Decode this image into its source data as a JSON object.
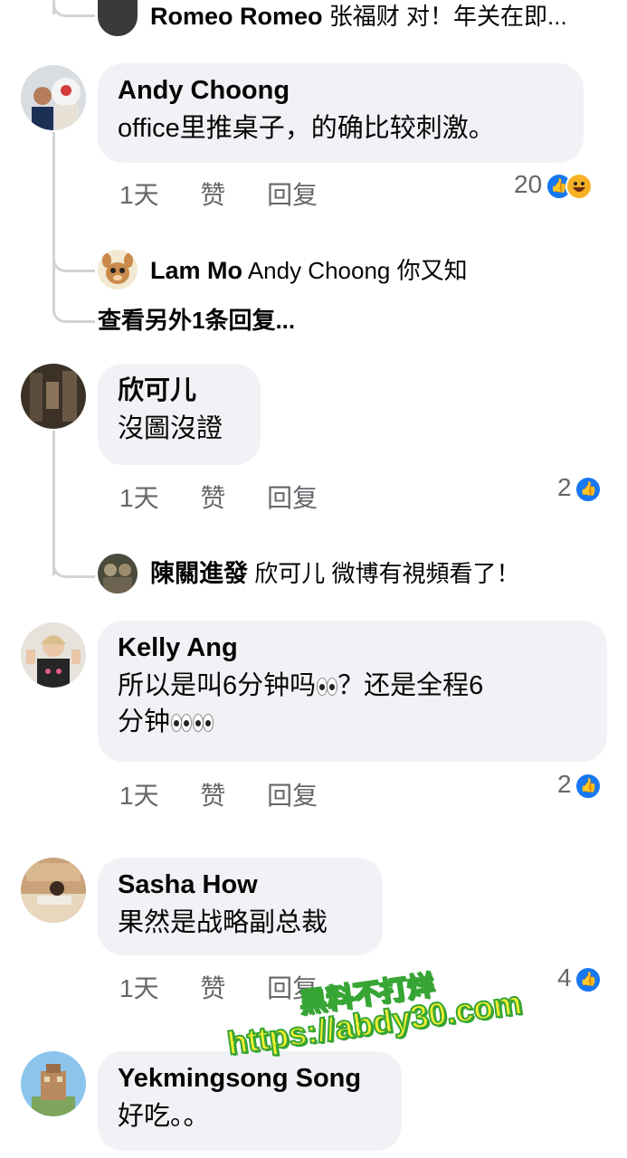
{
  "top_reply": {
    "name": "Romeo Romeo",
    "mention": "张福财",
    "text": "对！年关在即..."
  },
  "comments": [
    {
      "name": "Andy Choong",
      "text": "office里推桌子，的确比较刺激。",
      "time": "1天",
      "like": "赞",
      "reply": "回复",
      "reaction_count": "20",
      "replies": [
        {
          "name": "Lam Mo",
          "mention": "Andy Choong",
          "text": "你又知"
        }
      ],
      "more_replies": "查看另外1条回复..."
    },
    {
      "name": "欣可儿",
      "text": "沒圖沒證",
      "time": "1天",
      "like": "赞",
      "reply": "回复",
      "reaction_count": "2",
      "replies": [
        {
          "name": "陳關進發",
          "mention": "欣可儿",
          "text": "微博有視頻看了！"
        }
      ]
    },
    {
      "name": "Kelly Ang",
      "text_a": "所以是叫6分钟吗",
      "text_b": "？还是全程6",
      "text_c": "分钟",
      "time": "1天",
      "like": "赞",
      "reply": "回复",
      "reaction_count": "2"
    },
    {
      "name": "Sasha How",
      "text": "果然是战略副总裁",
      "time": "1天",
      "like": "赞",
      "reply": "回复",
      "reaction_count": "4"
    },
    {
      "name": "Yekmingsong Song",
      "text": "好吃。。"
    }
  ],
  "watermark": {
    "line1": "黑料不打烊",
    "line2": "https://abdy30.com"
  },
  "colors": {
    "bubble": "#f0f2f5",
    "like_blue": "#1877f2",
    "secondary_text": "#65676b",
    "thread_line": "#d0d3d8"
  }
}
